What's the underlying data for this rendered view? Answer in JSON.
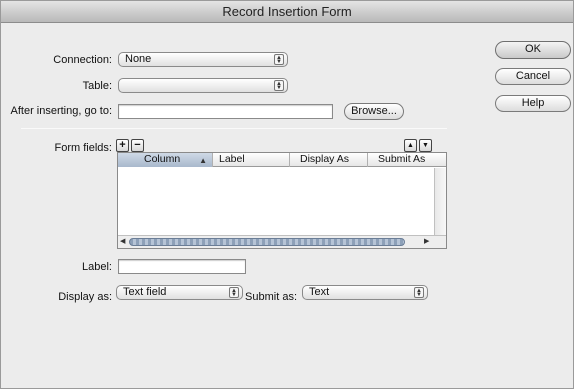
{
  "window": {
    "title": "Record Insertion Form"
  },
  "connection": {
    "label": "Connection:",
    "value": "None"
  },
  "table_field": {
    "label": "Table:",
    "value": ""
  },
  "after_inserting": {
    "label": "After inserting, go to:",
    "value": "",
    "browse_label": "Browse..."
  },
  "buttons": {
    "ok": "OK",
    "cancel": "Cancel",
    "help": "Help"
  },
  "form_fields": {
    "label": "Form fields:",
    "add_glyph": "+",
    "remove_glyph": "−",
    "columns": [
      "Column",
      "Label",
      "Display As",
      "Submit As"
    ],
    "sorted_column": "Column"
  },
  "field_label": {
    "label": "Label:",
    "value": ""
  },
  "display_as": {
    "label": "Display as:",
    "value": "Text field"
  },
  "submit_as": {
    "label": "Submit as:",
    "value": "Text"
  },
  "icons": [
    "plus-icon",
    "minus-icon",
    "up-arrow-icon",
    "down-arrow-icon",
    "sort-ascending-icon",
    "popup-arrows-icon",
    "scroll-left-icon",
    "scroll-right-icon"
  ]
}
